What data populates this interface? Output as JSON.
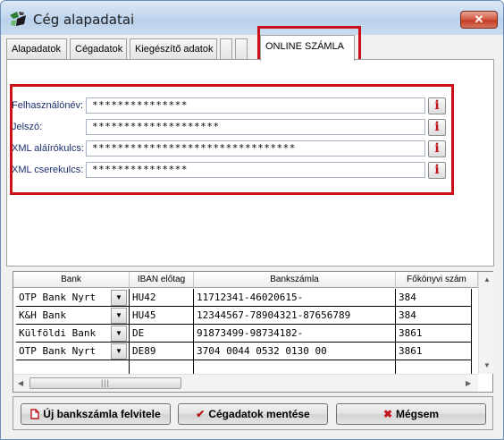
{
  "window": {
    "title": "Cég alapadatai",
    "close_label": "✕"
  },
  "tabs": [
    {
      "label": "Alapadatok"
    },
    {
      "label": "Cégadatok"
    },
    {
      "label": "Kiegészítő adatok"
    },
    {
      "label": ""
    },
    {
      "label": ""
    },
    {
      "label": "ONLINE SZÁMLA",
      "active": true
    }
  ],
  "online": {
    "fields": [
      {
        "label": "Felhasználónév:",
        "value": "***************"
      },
      {
        "label": "Jelszó:",
        "value": "********************"
      },
      {
        "label": "XML aláírókulcs:",
        "value": "********************************"
      },
      {
        "label": "XML cserekulcs:",
        "value": "***************"
      }
    ],
    "info_label": "i"
  },
  "bank_grid": {
    "columns": [
      "Bank",
      "IBAN előtag",
      "Bankszámla",
      "Főkönyvi szám"
    ],
    "rows": [
      {
        "bank": "OTP Bank Nyrt",
        "iban": "HU42",
        "account": "11712341-46020615-",
        "ledger": "384"
      },
      {
        "bank": "K&H Bank",
        "iban": "HU45",
        "account": "12344567-78904321-87656789",
        "ledger": "384"
      },
      {
        "bank": "Külföldi Bank",
        "iban": "DE",
        "account": "91873499-98734182-",
        "ledger": "3861"
      },
      {
        "bank": "OTP Bank Nyrt",
        "iban": "DE89",
        "account": "3704 0044 0532 0130 00",
        "ledger": "3861"
      }
    ]
  },
  "buttons": {
    "new_account": "Új bankszámla felvitele",
    "save": "Cégadatok mentése",
    "cancel": "Mégsem"
  },
  "colors": {
    "highlight_red": "#cc1018",
    "info_red": "#c0161c",
    "label_blue": "#1b2f6e"
  }
}
